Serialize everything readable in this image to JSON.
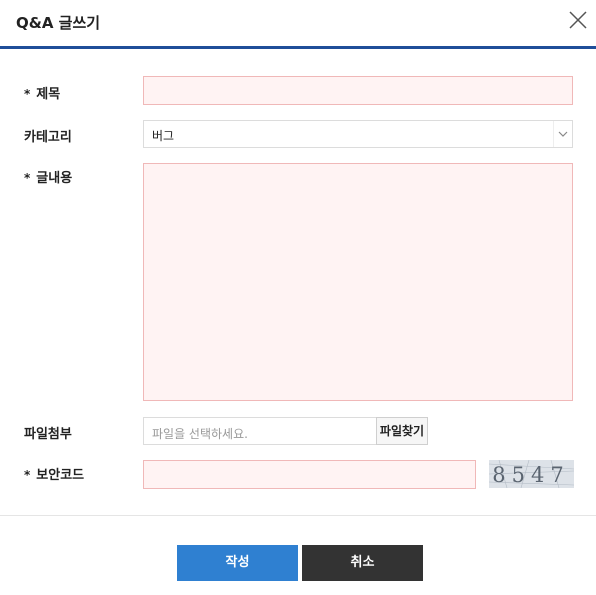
{
  "dialog": {
    "title": "Q&A 글쓰기"
  },
  "form": {
    "required_mark": "*",
    "subject": {
      "label": "제목",
      "value": ""
    },
    "category": {
      "label": "카테고리",
      "selected": "버그"
    },
    "content": {
      "label": "글내용",
      "value": ""
    },
    "attachment": {
      "label": "파일첨부",
      "placeholder": "파일을 선택하세요.",
      "button_label": "파일찾기"
    },
    "security_code": {
      "label": "보안코드",
      "value": "",
      "captcha_text": "8547"
    }
  },
  "buttons": {
    "submit": "작성",
    "cancel": "취소"
  },
  "colors": {
    "accent": "#1f4e99",
    "submit": "#2f80d1",
    "cancel": "#333333",
    "field_bg": "#fff3f3",
    "field_border": "#f0b8b8"
  },
  "icons": {
    "close": "close-icon",
    "chevron": "chevron-down-icon"
  }
}
